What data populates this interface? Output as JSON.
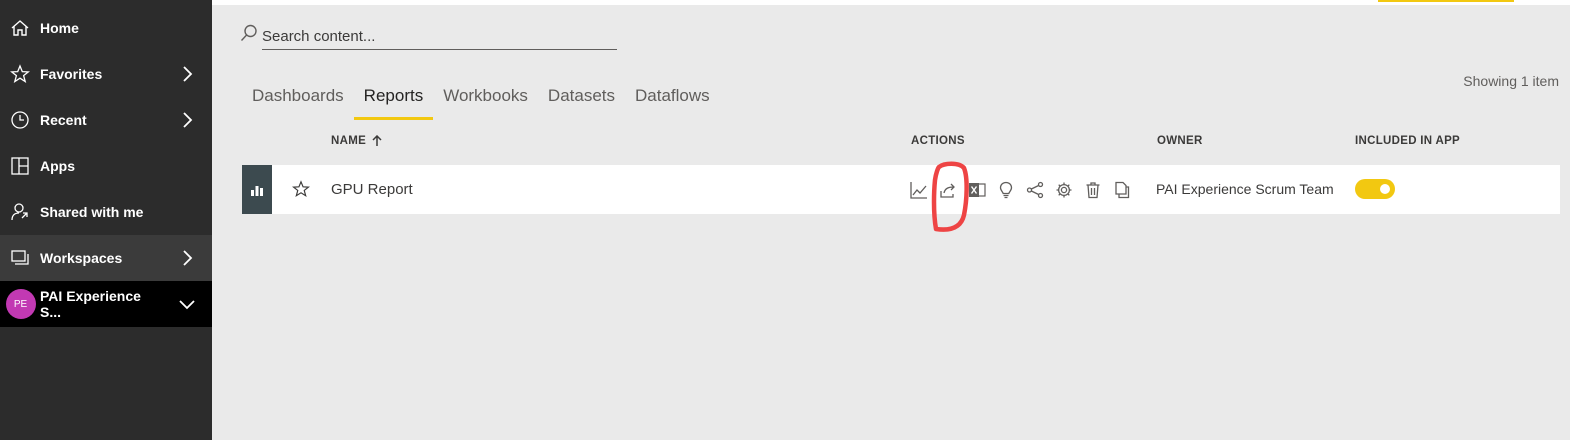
{
  "sidebar": {
    "items": [
      {
        "label": "Home",
        "icon": "home-icon"
      },
      {
        "label": "Favorites",
        "icon": "star-icon"
      },
      {
        "label": "Recent",
        "icon": "clock-icon"
      },
      {
        "label": "Apps",
        "icon": "apps-icon"
      },
      {
        "label": "Shared with me",
        "icon": "shared-icon"
      },
      {
        "label": "Workspaces",
        "icon": "workspaces-icon"
      }
    ],
    "current_workspace": {
      "label": "PAI Experience S...",
      "initials": "PE"
    }
  },
  "search": {
    "placeholder": "Search content..."
  },
  "tabs": [
    "Dashboards",
    "Reports",
    "Workbooks",
    "Datasets",
    "Dataflows"
  ],
  "active_tab": "Reports",
  "showing": "Showing 1 item",
  "table": {
    "columns": {
      "name": "NAME",
      "actions": "ACTIONS",
      "owner": "OWNER",
      "included": "INCLUDED IN APP"
    },
    "rows": [
      {
        "name": "GPU Report",
        "owner": "PAI Experience Scrum Team",
        "included_in_app": true,
        "actions": [
          "analytics-icon",
          "share-icon",
          "excel-icon",
          "insights-icon",
          "related-icon",
          "settings-icon",
          "delete-icon",
          "copy-icon"
        ]
      }
    ]
  },
  "colors": {
    "accent": "#f2c811",
    "sidebar_bg": "#2c2c2c",
    "avatar": "#c239b3",
    "annotation": "#ee4444"
  }
}
